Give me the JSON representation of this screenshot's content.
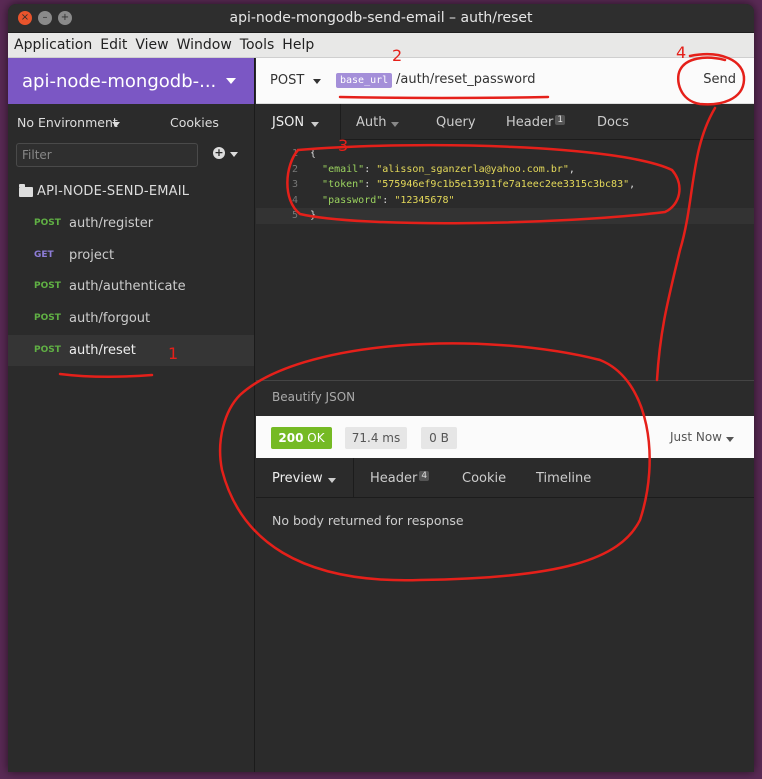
{
  "window": {
    "title": "api-node-mongodb-send-email – auth/reset"
  },
  "menu": [
    "Application",
    "Edit",
    "View",
    "Window",
    "Tools",
    "Help"
  ],
  "sidebar": {
    "workspace": "api-node-mongodb-...",
    "environment": "No Environment",
    "cookies": "Cookies",
    "filter_placeholder": "Filter",
    "folder": "API-NODE-SEND-EMAIL",
    "requests": [
      {
        "method": "POST",
        "name": "auth/register"
      },
      {
        "method": "GET",
        "name": "project"
      },
      {
        "method": "POST",
        "name": "auth/authenticate"
      },
      {
        "method": "POST",
        "name": "auth/forgout"
      },
      {
        "method": "POST",
        "name": "auth/reset"
      }
    ]
  },
  "request": {
    "method": "POST",
    "base_url_tag": "base_url",
    "path": "/auth/reset_password",
    "send": "Send",
    "tabs": {
      "body": "JSON",
      "auth": "Auth",
      "query": "Query",
      "header": "Header",
      "header_count": "1",
      "docs": "Docs"
    },
    "body_lines": [
      "{",
      "  \"email\": \"alisson_sganzerla@yahoo.com.br\",",
      "  \"token\": \"575946ef9c1b5e13911fe7a1eec2ee3315c3bc83\",",
      "  \"password\": \"12345678\"",
      "}"
    ],
    "line_numbers": [
      "1",
      "2",
      "3",
      "4",
      "5"
    ],
    "fields": [
      {
        "key": "\"email\"",
        "value": "\"alisson_sganzerla@yahoo.com.br\""
      },
      {
        "key": "\"token\"",
        "value": "\"575946ef9c1b5e13911fe7a1eec2ee3315c3bc83\""
      },
      {
        "key": "\"password\"",
        "value": "\"12345678\""
      }
    ]
  },
  "response": {
    "beautify": "Beautify JSON",
    "status_code": "200",
    "status_text": "OK",
    "time": "71.4 ms",
    "size": "0 B",
    "when": "Just Now",
    "tabs": {
      "preview": "Preview",
      "header": "Header",
      "header_count": "4",
      "cookie": "Cookie",
      "timeline": "Timeline"
    },
    "body_message": "No body returned for response"
  },
  "annotations": {
    "n1": "1",
    "n2": "2",
    "n3": "3",
    "n4": "4",
    "color": "#e5201a"
  }
}
